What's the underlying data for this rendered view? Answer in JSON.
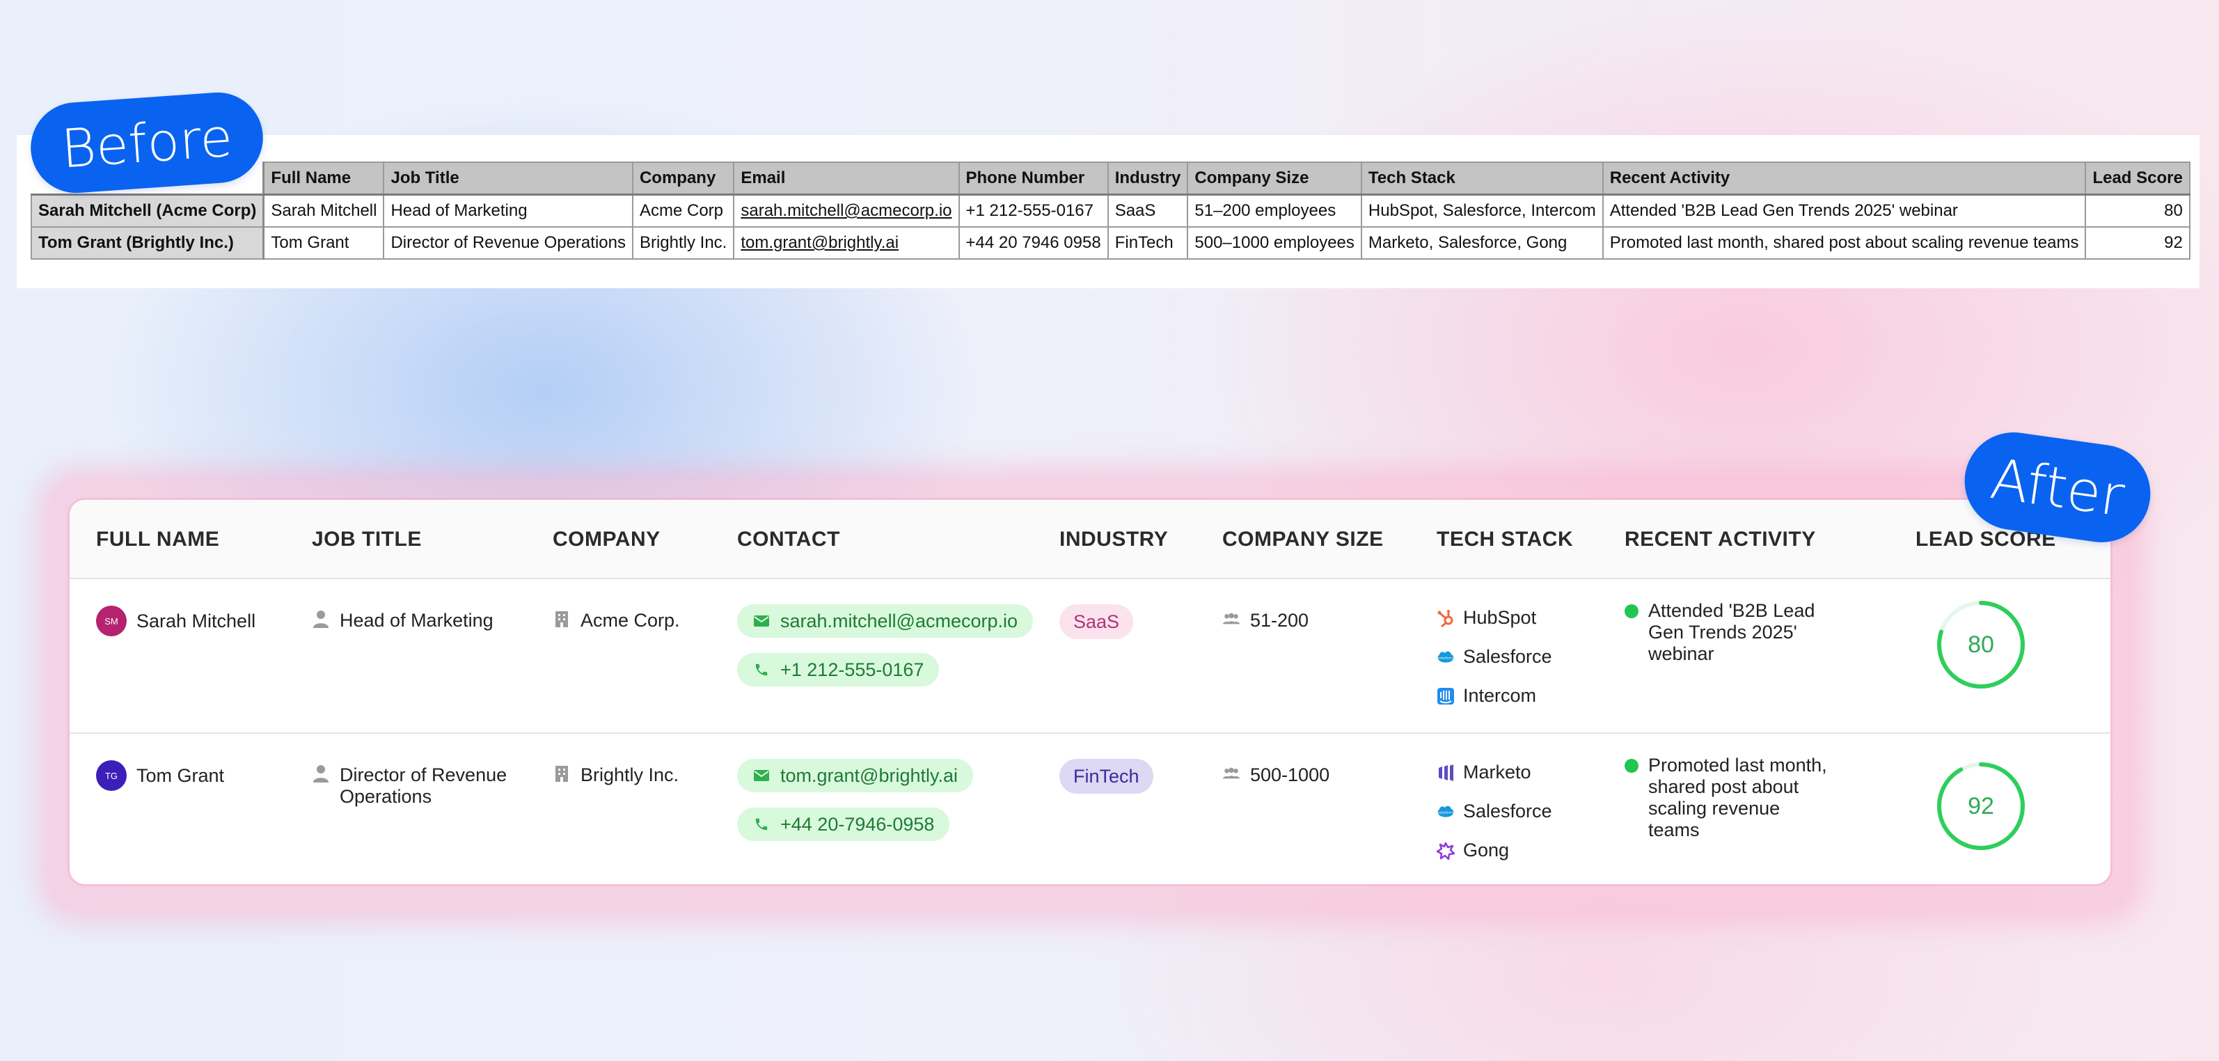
{
  "before": {
    "badge": "Before",
    "headers": [
      "",
      "Full Name",
      "Job Title",
      "Company",
      "Email",
      "Phone Number",
      "Industry",
      "Company Size",
      "Tech Stack",
      "Recent Activity",
      "Lead Score"
    ],
    "rows": [
      [
        "Sarah Mitchell (Acme Corp)",
        "Sarah Mitchell",
        "Head of Marketing",
        "Acme Corp",
        "sarah.mitchell@acmecorp.io",
        "+1 212-555-0167",
        "SaaS",
        "51–200 employees",
        "HubSpot, Salesforce, Intercom",
        "Attended 'B2B Lead Gen Trends 2025' webinar",
        "80"
      ],
      [
        "Tom Grant (Brightly Inc.)",
        "Tom Grant",
        "Director of Revenue Operations",
        "Brightly Inc.",
        "tom.grant@brightly.ai",
        "+44 20 7946 0958",
        "FinTech",
        "500–1000 employees",
        "Marketo, Salesforce, Gong",
        "Promoted last month, shared post about scaling revenue teams",
        "92"
      ]
    ]
  },
  "after": {
    "badge": "After",
    "headers": {
      "full_name": "FULL NAME",
      "job_title": "JOB TITLE",
      "company": "COMPANY",
      "contact": "CONTACT",
      "industry": "INDUSTRY",
      "company_size": "COMPANY SIZE",
      "tech_stack": "TECH STACK",
      "recent_activity": "RECENT ACTIVITY",
      "lead_score": "LEAD SCORE"
    },
    "rows": [
      {
        "initials": "SM",
        "avatar_color": "#b5226f",
        "name": "Sarah Mitchell",
        "title": "Head of Marketing",
        "company": "Acme Corp.",
        "email": "sarah.mitchell@acmecorp.io",
        "phone": "+1 212-555-0167",
        "industry": "SaaS",
        "industry_bg": "#fbe3ee",
        "industry_color": "#b0337a",
        "size": "51-200",
        "stack": [
          "HubSpot",
          "Salesforce",
          "Intercom"
        ],
        "activity": "Attended  'B2B Lead Gen Trends 2025' webinar",
        "score": 80
      },
      {
        "initials": "TG",
        "avatar_color": "#3b1fb8",
        "name": "Tom Grant",
        "title": "Director of Revenue Operations",
        "company": "Brightly Inc.",
        "email": "tom.grant@brightly.ai",
        "phone": "+44 20-7946-0958",
        "industry": "FinTech",
        "industry_bg": "#ddd8f3",
        "industry_color": "#3d2a9a",
        "size": "500-1000",
        "stack": [
          "Marketo",
          "Salesforce",
          "Gong"
        ],
        "activity": "Promoted last month, shared post about scaling revenue teams",
        "score": 92
      }
    ],
    "colors": {
      "accent_blue": "#0a63f0",
      "pill_green": "#d8f9dc",
      "score_green": "#2fce5c"
    }
  }
}
